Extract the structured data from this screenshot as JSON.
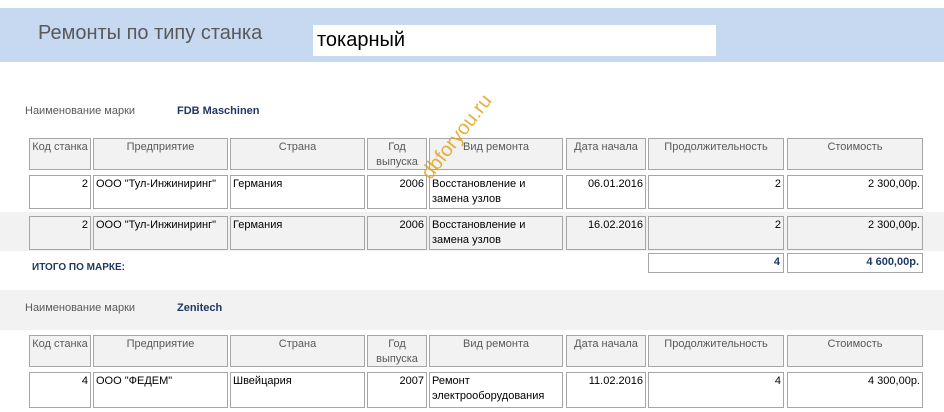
{
  "header": {
    "title": "Ремонты по типу станка",
    "filter_value": "токарный"
  },
  "columns": [
    "Код станка",
    "Предприятие",
    "Страна",
    "Год выпуска",
    "Вид ремонта",
    "Дата начала",
    "Продолжительность",
    "Стоимость"
  ],
  "groups": [
    {
      "label": "Наименование марки",
      "value": "FDB Maschinen",
      "rows": [
        {
          "code": "2",
          "company": "ООО \"Тул-Инжиниринг\"",
          "country": "Германия",
          "year": "2006",
          "repair": "Восстановление и замена узлов",
          "date": "06.01.2016",
          "duration": "2",
          "cost": "2 300,00р."
        },
        {
          "code": "2",
          "company": "ООО \"Тул-Инжиниринг\"",
          "country": "Германия",
          "year": "2006",
          "repair": "Восстановление и замена узлов",
          "date": "16.02.2016",
          "duration": "2",
          "cost": "2 300,00р."
        }
      ],
      "total_label": "ИТОГО ПО МАРКЕ:",
      "total_duration": "4",
      "total_cost": "4 600,00р."
    },
    {
      "label": "Наименование марки",
      "value": "Zenitech",
      "rows": [
        {
          "code": "4",
          "company": "ООО \"ФЕДЕМ\"",
          "country": "Швейцария",
          "year": "2007",
          "repair": "Ремонт электрооборудования",
          "date": "11.02.2016",
          "duration": "4",
          "cost": "4 300,00р."
        }
      ]
    }
  ],
  "watermark": "dbforyou.ru"
}
